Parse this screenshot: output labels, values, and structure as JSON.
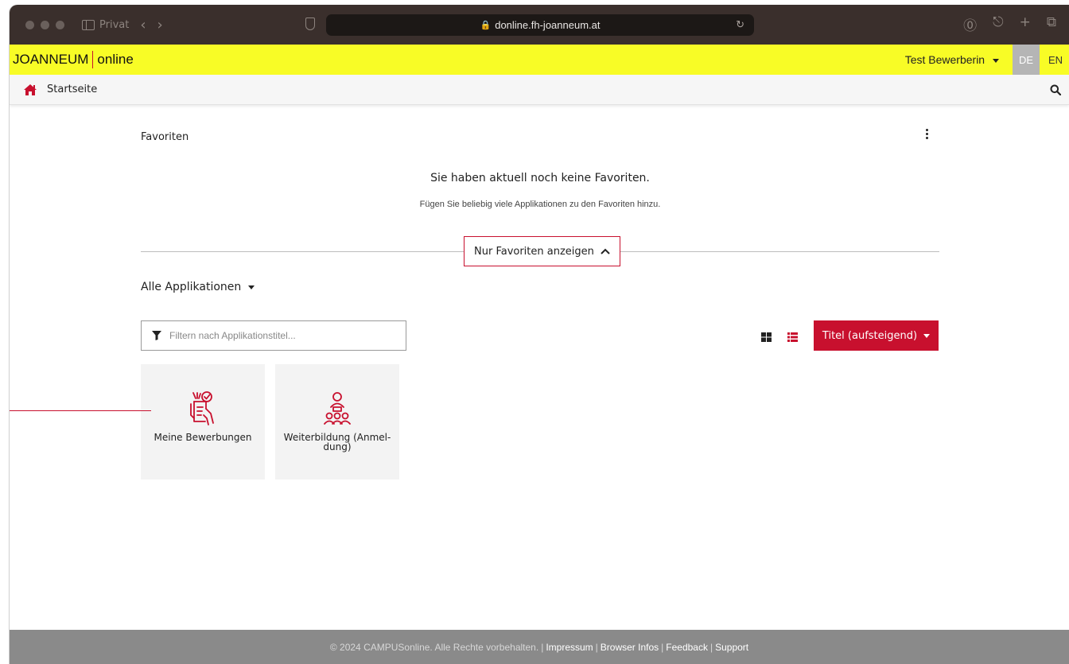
{
  "browser": {
    "private_label": "Privat",
    "url": "donline.fh-joanneum.at"
  },
  "header": {
    "logo_main": "JOANNEUM",
    "logo_sub": "online",
    "user": "Test Bewerberin",
    "lang_de": "DE",
    "lang_en": "EN"
  },
  "nav": {
    "home_label": "Startseite"
  },
  "favorites": {
    "title": "Favoriten",
    "empty_title": "Sie haben aktuell noch keine Favoriten.",
    "empty_sub": "Fügen Sie beliebig viele Applikationen zu den Favoriten hinzu.",
    "toggle_label": "Nur Favoriten anzeigen"
  },
  "apps": {
    "section_label": "Alle Applikationen",
    "filter_placeholder": "Filtern nach Applikationstitel...",
    "sort_label": "Titel (aufsteigend)",
    "tiles": [
      {
        "label": "Meine Bewerbungen"
      },
      {
        "label": "Weiterbildung (Anmel-dung)"
      }
    ]
  },
  "footer": {
    "copyright": "© 2024 CAMPUSonline. Alle Rechte vorbehalten.",
    "links": [
      "Impressum",
      "Browser Infos",
      "Feedback",
      "Support"
    ]
  },
  "colors": {
    "accent": "#c8102e",
    "header_yellow": "#f8fc26",
    "footer_gray": "#8a8a8a"
  }
}
